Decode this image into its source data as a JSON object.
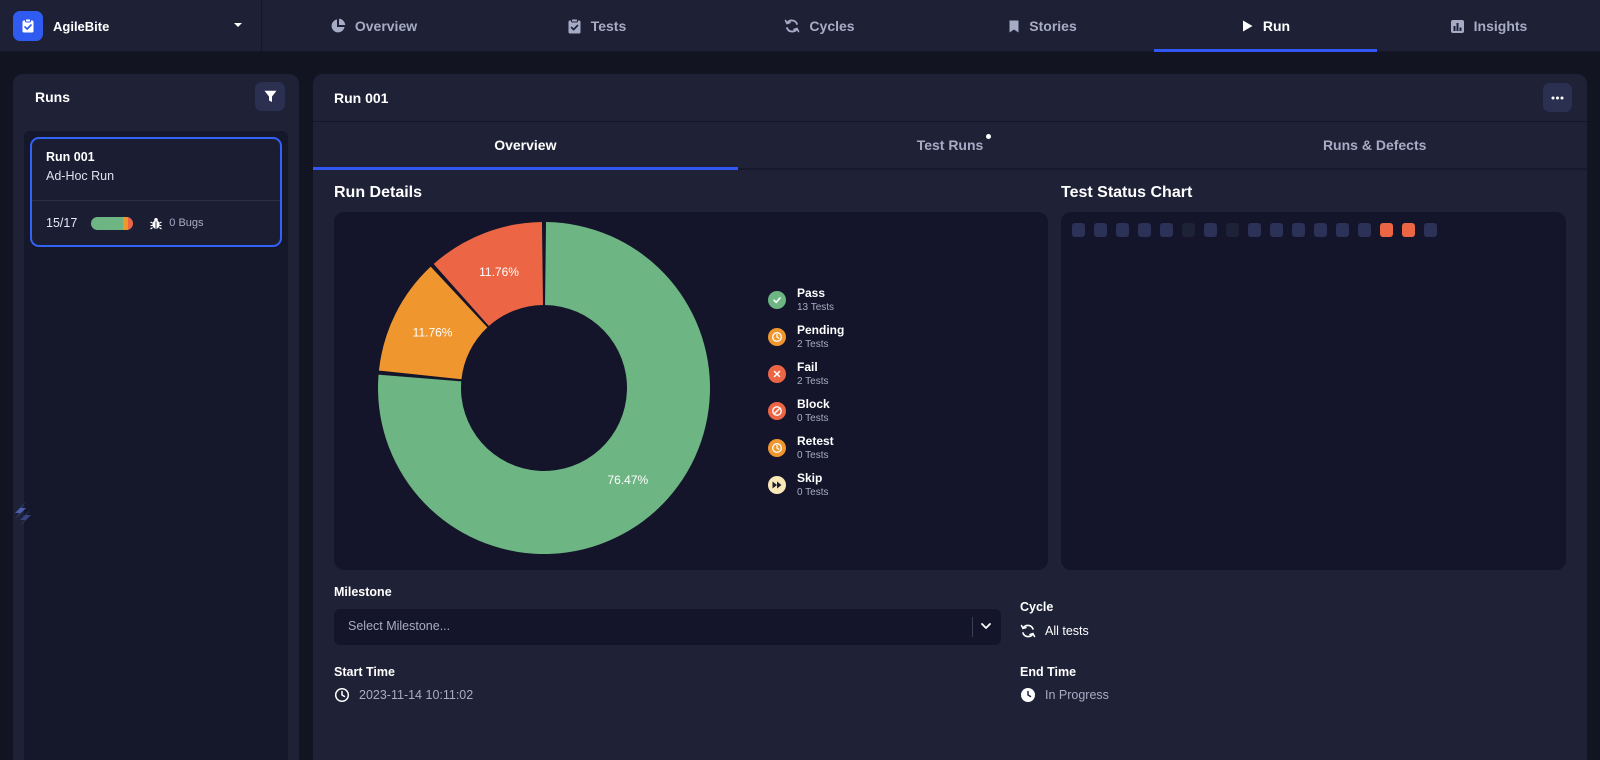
{
  "brand": {
    "name": "AgileBite",
    "logo_icon": "clipboard-check-icon"
  },
  "nav": {
    "tabs": [
      {
        "label": "Overview",
        "icon": "pie-icon"
      },
      {
        "label": "Tests",
        "icon": "clipboard-check-icon"
      },
      {
        "label": "Cycles",
        "icon": "cycle-icon"
      },
      {
        "label": "Stories",
        "icon": "bookmark-icon"
      },
      {
        "label": "Run",
        "icon": "play-icon"
      },
      {
        "label": "Insights",
        "icon": "bar-chart-icon"
      }
    ],
    "active": "Run"
  },
  "runs_panel": {
    "title": "Runs",
    "cards": [
      {
        "title": "Run 001",
        "subtitle": "Ad-Hoc Run",
        "progress": "15/17",
        "bugs": "0 Bugs",
        "progress_segments": {
          "pass": 13,
          "pending": 2,
          "fail": 2,
          "total": 17
        }
      }
    ]
  },
  "main": {
    "title": "Run 001",
    "tabs": [
      {
        "label": "Overview"
      },
      {
        "label": "Test Runs"
      },
      {
        "label": "Runs & Defects"
      }
    ],
    "active_tab": "Overview",
    "run_details_title": "Run Details",
    "status_chart_title": "Test Status Chart",
    "legend": [
      {
        "name": "Pass",
        "count": "13 Tests",
        "color": "#6db583",
        "icon": "check-icon"
      },
      {
        "name": "Pending",
        "count": "2 Tests",
        "color": "#f0962f",
        "icon": "clock-icon"
      },
      {
        "name": "Fail",
        "count": "2 Tests",
        "color": "#ec6646",
        "icon": "x-icon"
      },
      {
        "name": "Block",
        "count": "0 Tests",
        "color": "#ec6646",
        "icon": "block-icon"
      },
      {
        "name": "Retest",
        "count": "0 Tests",
        "color": "#f0962f",
        "icon": "clock-icon"
      },
      {
        "name": "Skip",
        "count": "0 Tests",
        "color": "#fbe8b8",
        "icon": "fast-forward-icon"
      }
    ],
    "milestone": {
      "label": "Milestone",
      "placeholder": "Select Milestone..."
    },
    "cycle": {
      "label": "Cycle",
      "value": "All tests"
    },
    "start_time": {
      "label": "Start Time",
      "value": "2023-11-14 10:11:02"
    },
    "end_time": {
      "label": "End Time",
      "value": "In Progress"
    },
    "status_squares": [
      "#2b3157",
      "#2b3157",
      "#2b3157",
      "#2b3157",
      "#2b3157",
      "#1e2238",
      "#2b3157",
      "#1e2238",
      "#2b3157",
      "#2b3157",
      "#2b3157",
      "#2b3157",
      "#2b3157",
      "#2b3157",
      "#ec6646",
      "#ec6646",
      "#2b3157"
    ]
  },
  "chart_data": {
    "type": "pie",
    "categories": [
      "Pass",
      "Pending",
      "Fail"
    ],
    "values": [
      76.47,
      11.76,
      11.76
    ],
    "labels": [
      "76.47%",
      "11.76%",
      "11.76%"
    ],
    "colors": [
      "#6db583",
      "#f0962f",
      "#ec6646"
    ],
    "donut": true
  }
}
